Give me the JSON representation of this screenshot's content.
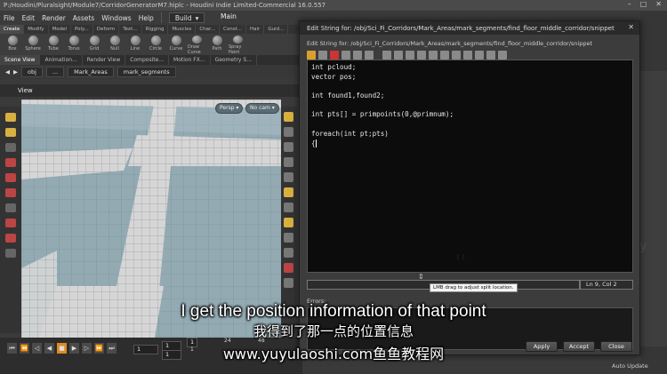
{
  "titlebar": {
    "title": "P:/Houdini/Pluralsight/Module7/CorridorGeneratorM7.hiplc - Houdini Indie Limited-Commercial 16.0.557",
    "minimize": "–",
    "maximize": "□",
    "close": "✕"
  },
  "menubar": {
    "items": [
      "File",
      "Edit",
      "Render",
      "Assets",
      "Windows",
      "Help"
    ],
    "build_label": "Build",
    "main_label": "Main"
  },
  "shelf": {
    "tabs": [
      "Create",
      "Modify",
      "Model",
      "Poly...",
      "Deform",
      "Text...",
      "Rigging",
      "Muscles",
      "Char...",
      "Const...",
      "Hair",
      "Guid..."
    ],
    "tools": [
      "Box",
      "Sphere",
      "Tube",
      "Torus",
      "Grid",
      "Null",
      "Line",
      "Circle",
      "Curve",
      "Draw Curve",
      "Path",
      "Spray Paint"
    ]
  },
  "panel_tabs": [
    "Scene View",
    "Animation...",
    "Render View",
    "Composite...",
    "Motion FX...",
    "Geometry S..."
  ],
  "path": {
    "root": "obj",
    "dots": "...",
    "crumb1": "Mark_Areas",
    "crumb2": "mark_segments"
  },
  "view": {
    "label": "View",
    "persp": "Persp ▾",
    "cam": "No cam ▾"
  },
  "playbar": {
    "frame_start": "1",
    "frame_cur": "1",
    "frame_a": "1",
    "frame_b": "1",
    "tick1": "1",
    "tick2": "24",
    "tick3": "48"
  },
  "network": {
    "auto_update": "Auto Update",
    "geometry_watermark": "etry"
  },
  "dialog": {
    "title": "Edit String for: /obj/Sci_Fi_Corridors/Mark_Areas/mark_segments/find_floor_middle_corridor/snippet",
    "subtitle": "Edit String for: /obj/Sci_Fi_Corridors/Mark_Areas/mark_segments/find_floor_middle_corridor/snippet",
    "close": "✕",
    "code_lines": [
      "int pcloud;",
      "vector pos;",
      "",
      "int found1,found2;",
      "",
      "int pts[] = primpoints(0,@primnum);",
      "",
      "foreach(int pt;pts)",
      "{"
    ],
    "cursor_pos": "Ln 9, Col 2",
    "errors_label": "Errors:",
    "tooltip": "LMB drag to adjust split location.",
    "apply": "Apply",
    "accept": "Accept",
    "close_btn": "Close"
  },
  "subtitles": {
    "english": "I get the position information of that point",
    "chinese": "我得到了那一点的位置信息",
    "watermark": "www.yuyulaoshi.com鱼鱼教程网"
  }
}
